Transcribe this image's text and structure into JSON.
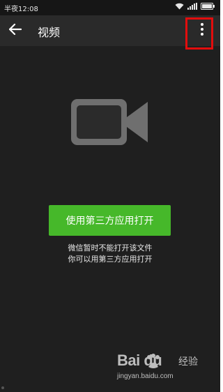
{
  "status_bar": {
    "time": "半夜12:08"
  },
  "app_bar": {
    "title": "视频"
  },
  "content": {
    "open_button_label": "使用第三方应用打开",
    "message_line1": "微信暂时不能打开该文件",
    "message_line2": "你可以用第三方应用打开"
  },
  "watermark": {
    "brand": "Bai  du",
    "brand_cn": "经验",
    "url": "jingyan.baidu.com"
  },
  "colors": {
    "background": "#1f1f1f",
    "app_bar": "#2a2a2a",
    "accent_green": "#46b82a",
    "highlight_red": "#e20d0d"
  },
  "icons": {
    "back": "back-arrow-icon",
    "more": "more-vertical-icon",
    "video": "video-camera-icon",
    "wifi": "wifi-icon",
    "signal": "signal-icon",
    "battery": "battery-icon"
  }
}
